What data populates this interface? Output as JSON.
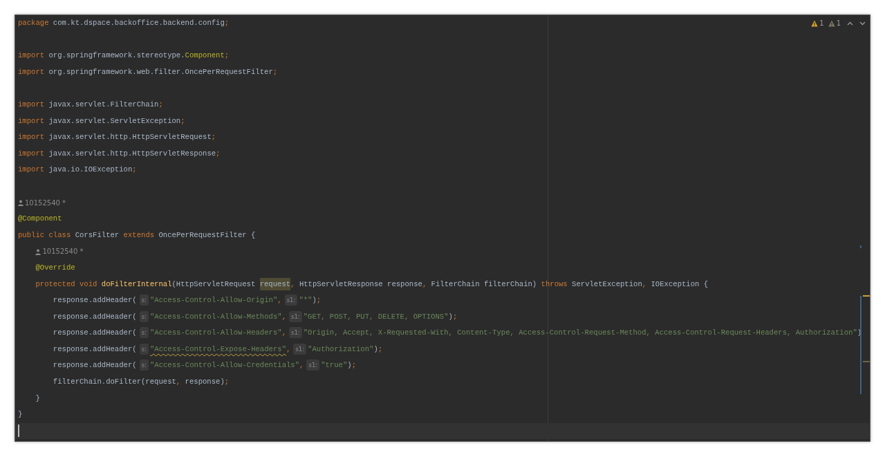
{
  "inspections": [
    {
      "color": "#d9a32b",
      "count": "1"
    },
    {
      "color": "#7f7b63",
      "count": "1"
    }
  ],
  "lines": [
    {
      "kind": "code",
      "tokens": [
        {
          "kind": "kw",
          "text": "package"
        },
        {
          "kind": "plain",
          "text": " com.kt.dspace.backoffice.backend.config"
        },
        {
          "kind": "punct",
          "text": ";"
        }
      ]
    },
    {
      "kind": "blank"
    },
    {
      "kind": "code",
      "tokens": [
        {
          "kind": "kw",
          "text": "import"
        },
        {
          "kind": "plain",
          "text": " org.springframework.stereotype."
        },
        {
          "kind": "ann",
          "text": "Component"
        },
        {
          "kind": "punct",
          "text": ";"
        }
      ]
    },
    {
      "kind": "code",
      "tokens": [
        {
          "kind": "kw",
          "text": "import"
        },
        {
          "kind": "plain",
          "text": " org.springframework.web.filter.OncePerRequestFilter"
        },
        {
          "kind": "punct",
          "text": ";"
        }
      ]
    },
    {
      "kind": "blank"
    },
    {
      "kind": "code",
      "tokens": [
        {
          "kind": "kw",
          "text": "import"
        },
        {
          "kind": "plain",
          "text": " javax.servlet.FilterChain"
        },
        {
          "kind": "punct",
          "text": ";"
        }
      ]
    },
    {
      "kind": "code",
      "tokens": [
        {
          "kind": "kw",
          "text": "import"
        },
        {
          "kind": "plain",
          "text": " javax.servlet.ServletException"
        },
        {
          "kind": "punct",
          "text": ";"
        }
      ]
    },
    {
      "kind": "code",
      "tokens": [
        {
          "kind": "kw",
          "text": "import"
        },
        {
          "kind": "plain",
          "text": " javax.servlet.http.HttpServletRequest"
        },
        {
          "kind": "punct",
          "text": ";"
        }
      ]
    },
    {
      "kind": "code",
      "tokens": [
        {
          "kind": "kw",
          "text": "import"
        },
        {
          "kind": "plain",
          "text": " javax.servlet.http.HttpServletResponse"
        },
        {
          "kind": "punct",
          "text": ";"
        }
      ]
    },
    {
      "kind": "code",
      "tokens": [
        {
          "kind": "kw",
          "text": "import"
        },
        {
          "kind": "plain",
          "text": " java.io.IOException"
        },
        {
          "kind": "punct",
          "text": ";"
        }
      ]
    },
    {
      "kind": "blank"
    },
    {
      "kind": "author",
      "author": "10152540 *"
    },
    {
      "kind": "code",
      "tokens": [
        {
          "kind": "ann",
          "text": "@Component"
        }
      ]
    },
    {
      "kind": "code",
      "tokens": [
        {
          "kind": "kw",
          "text": "public class "
        },
        {
          "kind": "plain",
          "text": "CorsFilter "
        },
        {
          "kind": "kw",
          "text": "extends "
        },
        {
          "kind": "plain",
          "text": "OncePerRequestFilter {"
        }
      ],
      "children": [
        {
          "kind": "author",
          "author": "10152540 *"
        },
        {
          "kind": "code",
          "tokens": [
            {
              "kind": "ann",
              "text": "@Override"
            }
          ]
        },
        {
          "kind": "code",
          "tokens": [
            {
              "kind": "kw",
              "text": "protected void "
            },
            {
              "kind": "method",
              "text": "doFilterInternal"
            },
            {
              "kind": "plain",
              "text": "(HttpServletRequest "
            },
            {
              "kind": "hl",
              "text": "request"
            },
            {
              "kind": "punct",
              "text": ","
            },
            {
              "kind": "plain",
              "text": " HttpServletResponse response"
            },
            {
              "kind": "punct",
              "text": ","
            },
            {
              "kind": "plain",
              "text": " FilterChain filterChain) "
            },
            {
              "kind": "kw",
              "text": "throws "
            },
            {
              "kind": "plain",
              "text": "ServletException"
            },
            {
              "kind": "punct",
              "text": ","
            },
            {
              "kind": "plain",
              "text": " IOException {"
            }
          ],
          "children": [
            {
              "kind": "code",
              "tokens": [
                {
                  "kind": "plain",
                  "text": "response.addHeader("
                },
                {
                  "kind": "hint",
                  "text": "s:"
                },
                {
                  "kind": "str",
                  "text": "\"Access-Control-Allow-Origin\""
                },
                {
                  "kind": "punct",
                  "text": ","
                },
                {
                  "kind": "hint",
                  "text": "s1:"
                },
                {
                  "kind": "str",
                  "text": "\"*\""
                },
                {
                  "kind": "plain",
                  "text": ")"
                },
                {
                  "kind": "punct",
                  "text": ";"
                }
              ]
            },
            {
              "kind": "code",
              "tokens": [
                {
                  "kind": "plain",
                  "text": "response.addHeader("
                },
                {
                  "kind": "hint",
                  "text": "s:"
                },
                {
                  "kind": "str",
                  "text": "\"Access-Control-Allow-Methods\""
                },
                {
                  "kind": "punct",
                  "text": ","
                },
                {
                  "kind": "hint",
                  "text": "s1:"
                },
                {
                  "kind": "str",
                  "text": "\"GET, POST, PUT, DELETE, OPTIONS\""
                },
                {
                  "kind": "plain",
                  "text": ")"
                },
                {
                  "kind": "punct",
                  "text": ";"
                }
              ]
            },
            {
              "kind": "code",
              "tokens": [
                {
                  "kind": "plain",
                  "text": "response.addHeader("
                },
                {
                  "kind": "hint",
                  "text": "s:"
                },
                {
                  "kind": "str",
                  "text": "\"Access-Control-Allow-Headers\""
                },
                {
                  "kind": "punct",
                  "text": ","
                },
                {
                  "kind": "hint",
                  "text": "s1:"
                },
                {
                  "kind": "str",
                  "text": "\"Origin, Accept, X-Requested-With, Content-Type, Access-Control-Request-Method, Access-Control-Request-Headers, Authorization\""
                },
                {
                  "kind": "plain",
                  "text": ")"
                }
              ]
            },
            {
              "kind": "code",
              "tokens": [
                {
                  "kind": "plain",
                  "text": "response.addHeader("
                },
                {
                  "kind": "hint",
                  "text": "s:"
                },
                {
                  "kind": "warn",
                  "text": "\"Access-Control-Expose-Headers\""
                },
                {
                  "kind": "punct",
                  "text": ","
                },
                {
                  "kind": "hint",
                  "text": "s1:"
                },
                {
                  "kind": "str",
                  "text": "\"Authorization\""
                },
                {
                  "kind": "plain",
                  "text": ")"
                },
                {
                  "kind": "punct",
                  "text": ";"
                }
              ]
            },
            {
              "kind": "code",
              "tokens": [
                {
                  "kind": "plain",
                  "text": "response.addHeader("
                },
                {
                  "kind": "hint",
                  "text": "s:"
                },
                {
                  "kind": "str",
                  "text": "\"Access-Control-Allow-Credentials\""
                },
                {
                  "kind": "punct",
                  "text": ","
                },
                {
                  "kind": "hint",
                  "text": "s1:"
                },
                {
                  "kind": "str",
                  "text": "\"true\""
                },
                {
                  "kind": "plain",
                  "text": ")"
                },
                {
                  "kind": "punct",
                  "text": ";"
                }
              ]
            },
            {
              "kind": "code",
              "tokens": [
                {
                  "kind": "plain",
                  "text": "filterChain.doFilter(request"
                },
                {
                  "kind": "punct",
                  "text": ","
                },
                {
                  "kind": "plain",
                  "text": " response)"
                },
                {
                  "kind": "punct",
                  "text": ";"
                }
              ]
            }
          ]
        },
        {
          "kind": "code",
          "tokens": [
            {
              "kind": "plain",
              "text": "}"
            }
          ]
        }
      ]
    },
    {
      "kind": "code",
      "tokens": [
        {
          "kind": "plain",
          "text": "}"
        }
      ]
    },
    {
      "kind": "caret"
    }
  ]
}
